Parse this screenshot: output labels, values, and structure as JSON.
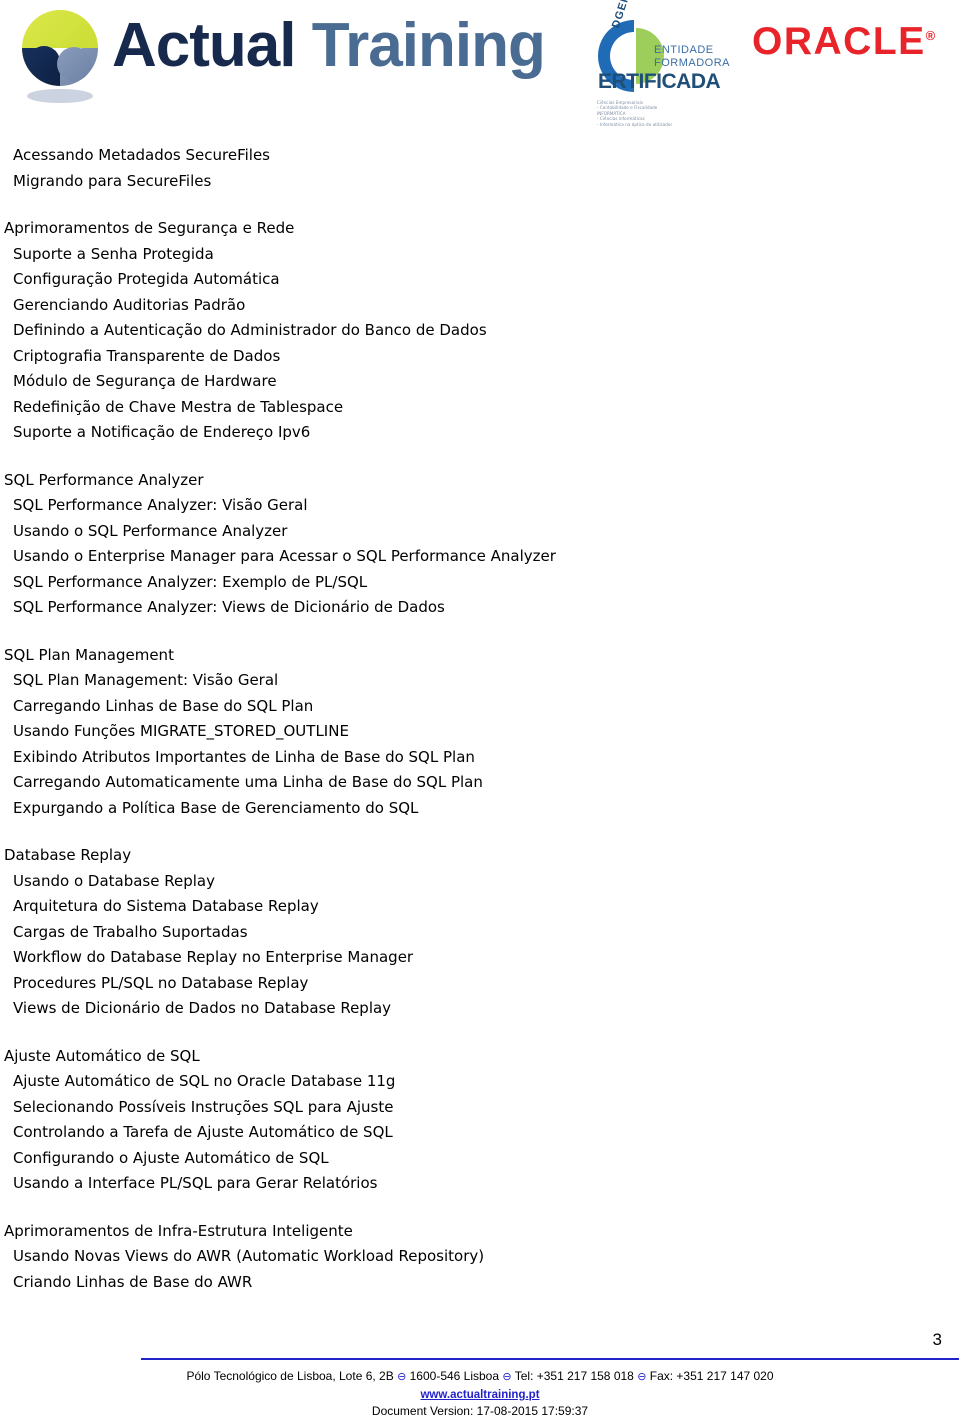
{
  "header": {
    "company_logo": {
      "name_part1": "Actual",
      "name_part2": "Training"
    },
    "dgert_logo": {
      "rotated_word": "DGERT",
      "line1": "ENTIDADE",
      "line2": "FORMADORA",
      "certified": "ERTIFICADA",
      "fine_print": "Ciências Empresariais\n- Contabilidade e Fiscalidade\nINFORMÁTICA\n- Ciências informáticas\n- Informática na óptica do utilizador"
    },
    "oracle_logo": {
      "text": "ORACLE",
      "registered": "®"
    }
  },
  "content": {
    "groups": [
      {
        "heading": null,
        "items": [
          "Acessando Metadados SecureFiles",
          "Migrando para SecureFiles"
        ]
      },
      {
        "heading": "Aprimoramentos de Segurança e Rede",
        "items": [
          "Suporte a Senha Protegida",
          "Configuração Protegida Automática",
          "Gerenciando Auditorias Padrão",
          "Definindo a Autenticação do Administrador do Banco de Dados",
          "Criptografia Transparente de Dados",
          "Módulo de Segurança de Hardware",
          "Redefinição de Chave Mestra de Tablespace",
          "Suporte a Notificação de Endereço Ipv6"
        ]
      },
      {
        "heading": "SQL Performance Analyzer",
        "items": [
          "SQL Performance Analyzer: Visão Geral",
          "Usando o SQL Performance Analyzer",
          "Usando o Enterprise Manager para Acessar o SQL Performance Analyzer",
          "SQL Performance Analyzer: Exemplo de PL/SQL",
          "SQL Performance Analyzer: Views de Dicionário de Dados"
        ]
      },
      {
        "heading": "SQL Plan Management",
        "items": [
          "SQL Plan Management: Visão Geral",
          "Carregando Linhas de Base do SQL Plan",
          "Usando Funções MIGRATE_STORED_OUTLINE",
          "Exibindo Atributos Importantes de Linha de Base do SQL Plan",
          "Carregando Automaticamente uma Linha de Base do SQL Plan",
          "Expurgando a Política Base de Gerenciamento do SQL"
        ]
      },
      {
        "heading": "Database Replay",
        "items": [
          "Usando o Database Replay",
          "Arquitetura do Sistema Database Replay",
          "Cargas de Trabalho Suportadas",
          "Workflow do Database Replay no Enterprise Manager",
          "Procedures PL/SQL no Database Replay",
          "Views de Dicionário de Dados no Database Replay"
        ]
      },
      {
        "heading": "Ajuste Automático de SQL",
        "items": [
          "Ajuste Automático de SQL no Oracle Database 11g",
          "Selecionando Possíveis Instruções SQL para Ajuste",
          "Controlando a Tarefa de Ajuste Automático de SQL",
          "Configurando o Ajuste Automático de SQL",
          "Usando a Interface PL/SQL para Gerar Relatórios"
        ]
      },
      {
        "heading": "Aprimoramentos de Infra-Estrutura Inteligente",
        "items": [
          "Usando Novas Views do AWR (Automatic Workload Repository)",
          "Criando Linhas de Base do AWR"
        ]
      }
    ]
  },
  "footer": {
    "page_number": "3",
    "address": "Pólo Tecnológico de Lisboa, Lote 6, 2B",
    "separator": "⊖",
    "postal": "1600-546 Lisboa",
    "phone": "Tel: +351 217 158 018",
    "fax": "Fax: +351 217 147 020",
    "website": "www.actualtraining.pt",
    "version": "Document Version: 17-08-2015 17:59:37"
  },
  "colors": {
    "brand_navy": "#17294d",
    "brand_steel": "#4a6b92",
    "oracle_red": "#e8242a",
    "dgert_blue": "#1f4e79",
    "footer_blue": "#2222cc"
  }
}
